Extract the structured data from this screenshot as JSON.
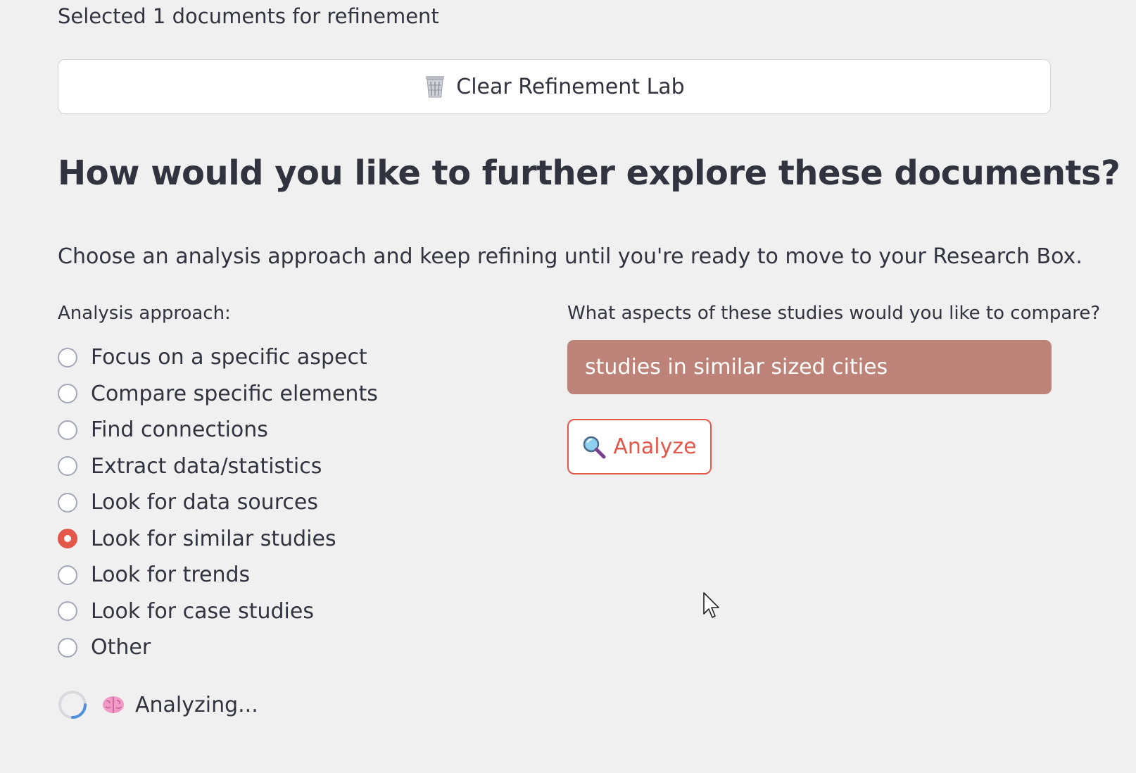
{
  "selection": {
    "note": "Selected 1 documents for refinement"
  },
  "clear_button": {
    "icon": "wastebasket-icon",
    "label": "Clear Refinement Lab"
  },
  "heading": "How would you like to further explore these documents?",
  "subtext": "Choose an analysis approach and keep refining until you're ready to move to your Research Box.",
  "analysis": {
    "label": "Analysis approach:",
    "options": [
      {
        "label": "Focus on a specific aspect",
        "selected": false
      },
      {
        "label": "Compare specific elements",
        "selected": false
      },
      {
        "label": "Find connections",
        "selected": false
      },
      {
        "label": "Extract data/statistics",
        "selected": false
      },
      {
        "label": "Look for data sources",
        "selected": false
      },
      {
        "label": "Look for similar studies",
        "selected": true
      },
      {
        "label": "Look for trends",
        "selected": false
      },
      {
        "label": "Look for case studies",
        "selected": false
      },
      {
        "label": "Other",
        "selected": false
      }
    ]
  },
  "compare": {
    "label": "What aspects of these studies would you like to compare?",
    "value": "studies in similar sized cities"
  },
  "analyze_button": {
    "icon": "magnifier-icon",
    "label": "Analyze"
  },
  "status": {
    "icon": "brain-icon",
    "text": "Analyzing..."
  },
  "colors": {
    "accent": "#e4574b",
    "input_fill": "#bd8379",
    "background": "#f0f0f0",
    "text": "#31333f"
  }
}
